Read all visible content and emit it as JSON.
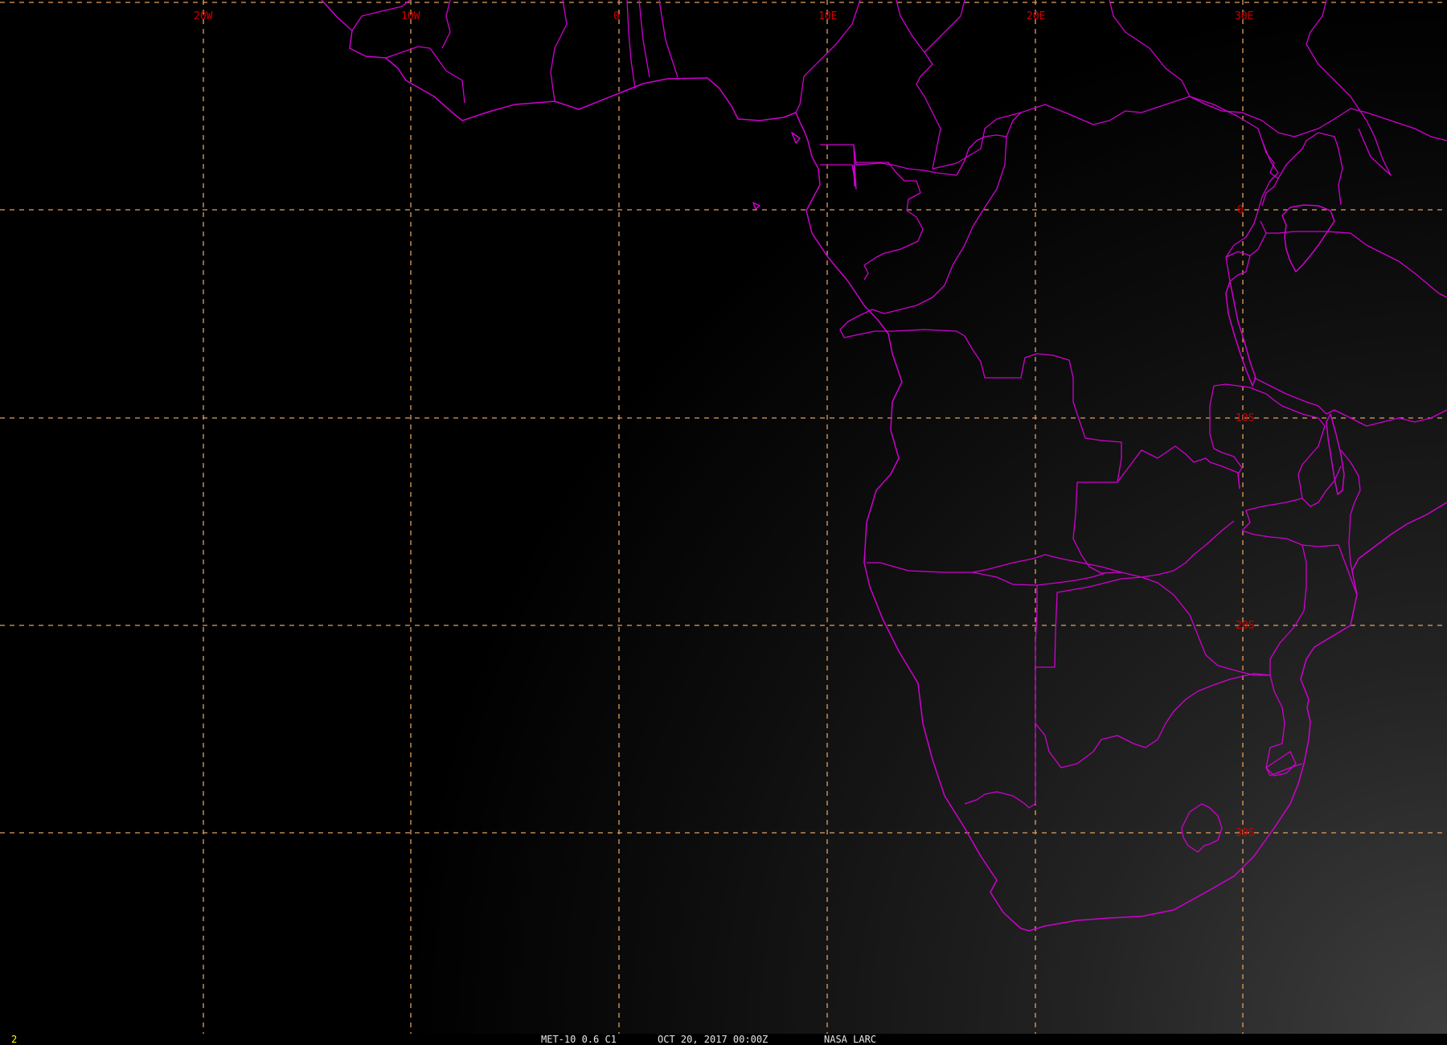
{
  "map": {
    "longitude_labels": [
      "20W",
      "10W",
      "0",
      "10E",
      "20E",
      "30E"
    ],
    "latitude_labels": [
      "0",
      "10S",
      "20S",
      "30S"
    ]
  },
  "status": {
    "frame_number": "2",
    "satellite_band": "MET-10 0.6 C1",
    "datetime": "OCT 20, 2017 00:00Z",
    "organization": "NASA LARC"
  },
  "colors": {
    "background": "#000000",
    "boundaries": "#d000d0",
    "gridlines": "#e0a060",
    "grid_labels": "#d00000",
    "frame_number": "#ffff00",
    "status_text": "#e8e8e8"
  }
}
